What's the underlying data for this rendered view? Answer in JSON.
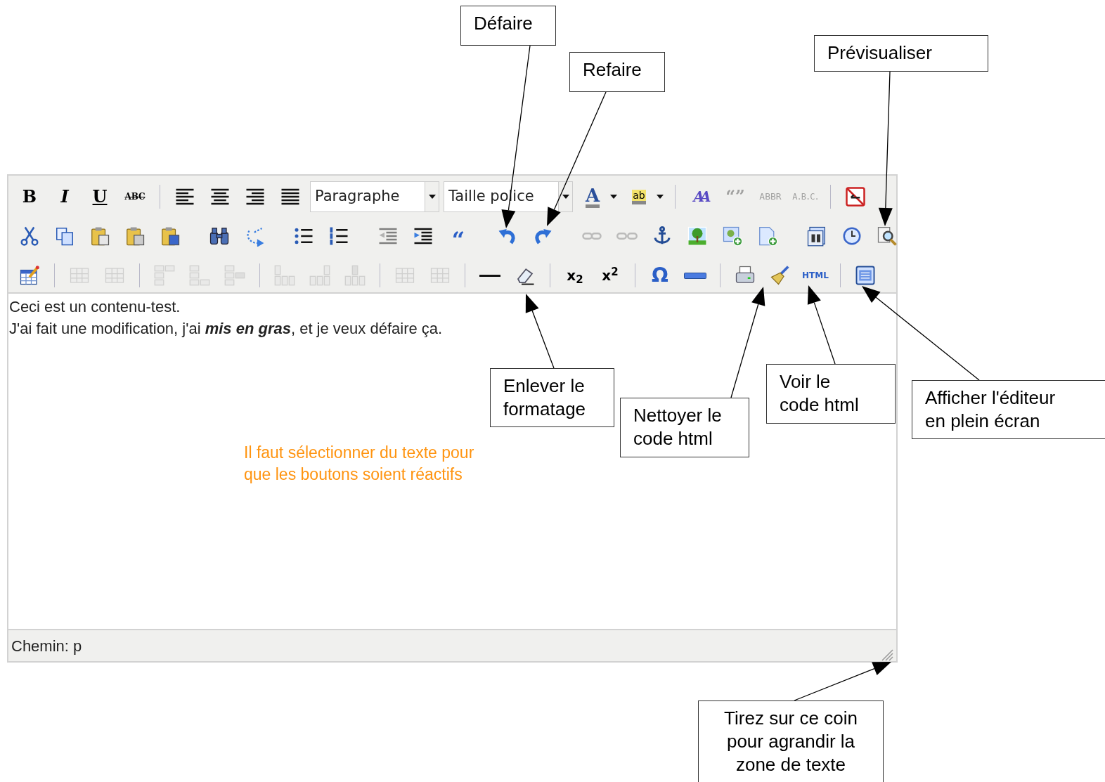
{
  "toolbar": {
    "rows": [
      [
        {
          "kind": "bold",
          "glyph": "B",
          "disabled": false
        },
        {
          "kind": "italic",
          "glyph": "I",
          "disabled": false
        },
        {
          "kind": "underline",
          "glyph": "U",
          "disabled": false
        },
        {
          "kind": "strike",
          "glyph": "ABC",
          "disabled": false
        },
        {
          "kind": "separator"
        },
        {
          "kind": "alignleft",
          "disabled": false
        },
        {
          "kind": "aligncenter",
          "disabled": false
        },
        {
          "kind": "alignright",
          "disabled": false
        },
        {
          "kind": "alignjustify",
          "disabled": false
        },
        {
          "kind": "select",
          "value": "Paragraphe"
        },
        {
          "kind": "select",
          "value": "Taille police"
        },
        {
          "kind": "forecolor",
          "glyph": "A",
          "disabled": false
        },
        {
          "kind": "caret",
          "disabled": false
        },
        {
          "kind": "backcolor",
          "glyph": "ab",
          "disabled": false
        },
        {
          "kind": "caret",
          "disabled": false
        },
        {
          "kind": "separator"
        },
        {
          "kind": "styleprops",
          "glyph": "AA",
          "disabled": false
        },
        {
          "kind": "cite",
          "glyph": "“”",
          "disabled": true
        },
        {
          "kind": "abbr",
          "glyph": "ABBR",
          "disabled": true
        },
        {
          "kind": "acronym",
          "glyph": "A.B.C.",
          "disabled": true
        },
        {
          "kind": "separator"
        },
        {
          "kind": "visualaid",
          "disabled": false
        }
      ],
      [
        {
          "kind": "cut",
          "disabled": false
        },
        {
          "kind": "copy",
          "disabled": false
        },
        {
          "kind": "paste",
          "disabled": false
        },
        {
          "kind": "pastetext",
          "disabled": false
        },
        {
          "kind": "pasteword",
          "disabled": false
        },
        {
          "kind": "separator"
        },
        {
          "kind": "search",
          "disabled": false
        },
        {
          "kind": "replace",
          "disabled": false
        },
        {
          "kind": "separator"
        },
        {
          "kind": "bullist",
          "disabled": false
        },
        {
          "kind": "numlist",
          "disabled": false
        },
        {
          "kind": "separator"
        },
        {
          "kind": "outdent",
          "disabled": true
        },
        {
          "kind": "indent",
          "disabled": false
        },
        {
          "kind": "blockquote",
          "glyph": "“",
          "disabled": false
        },
        {
          "kind": "separator"
        },
        {
          "kind": "undo",
          "disabled": false
        },
        {
          "kind": "redo",
          "disabled": false
        },
        {
          "kind": "separator"
        },
        {
          "kind": "link",
          "disabled": true
        },
        {
          "kind": "unlink",
          "disabled": true
        },
        {
          "kind": "anchor",
          "disabled": false
        },
        {
          "kind": "image",
          "disabled": false
        },
        {
          "kind": "insertimage",
          "disabled": false
        },
        {
          "kind": "insertfile",
          "disabled": false
        },
        {
          "kind": "separator"
        },
        {
          "kind": "date",
          "disabled": false
        },
        {
          "kind": "time",
          "disabled": false
        },
        {
          "kind": "preview",
          "disabled": false
        }
      ],
      [
        {
          "kind": "table",
          "disabled": false
        },
        {
          "kind": "separator"
        },
        {
          "kind": "rowprops",
          "disabled": true
        },
        {
          "kind": "cellprops",
          "disabled": true
        },
        {
          "kind": "separator"
        },
        {
          "kind": "rowbefore",
          "disabled": true
        },
        {
          "kind": "rowafter",
          "disabled": true
        },
        {
          "kind": "deleterow",
          "disabled": true
        },
        {
          "kind": "separator"
        },
        {
          "kind": "colbefore",
          "disabled": true
        },
        {
          "kind": "colafter",
          "disabled": true
        },
        {
          "kind": "deletecol",
          "disabled": true
        },
        {
          "kind": "separator"
        },
        {
          "kind": "splitcells",
          "disabled": true
        },
        {
          "kind": "mergecells",
          "disabled": true
        },
        {
          "kind": "separator"
        },
        {
          "kind": "hr",
          "disabled": false
        },
        {
          "kind": "removeformat",
          "disabled": false
        },
        {
          "kind": "separator"
        },
        {
          "kind": "sub",
          "glyph": "x$_{2}$",
          "disabled": false
        },
        {
          "kind": "sup",
          "glyph": "x$^{2}$",
          "disabled": false
        },
        {
          "kind": "separator"
        },
        {
          "kind": "charmap",
          "glyph": "Ω",
          "disabled": false
        },
        {
          "kind": "advhr",
          "disabled": false
        },
        {
          "kind": "separator"
        },
        {
          "kind": "print",
          "disabled": false
        },
        {
          "kind": "cleanup",
          "disabled": false
        },
        {
          "kind": "code",
          "glyph": "HTML",
          "disabled": false
        },
        {
          "kind": "separator"
        },
        {
          "kind": "fullscreen",
          "disabled": false
        }
      ]
    ]
  },
  "content": {
    "lines": [
      "Ceci est un contenu-test.",
      "J'ai fait une modification, j'ai **mis en gras**, et je veux défaire ça."
    ]
  },
  "status_bar": {
    "path": "Chemin: p"
  },
  "note": {
    "lines": [
      "Il faut sélectionner du texte pour",
      "que les boutons soient réactifs"
    ]
  },
  "callouts": [
    {
      "lines": [
        "Défaire"
      ]
    },
    {
      "lines": [
        "Refaire"
      ]
    },
    {
      "lines": [
        "Prévisualiser"
      ]
    },
    {
      "lines": [
        "Enlever le",
        "formatage"
      ]
    },
    {
      "lines": [
        "Nettoyer le",
        "code html"
      ]
    },
    {
      "lines": [
        "Voir le",
        "code html"
      ]
    },
    {
      "lines": [
        "Afficher l'éditeur",
        "en plein écran"
      ]
    },
    {
      "lines": [
        "Tirez sur ce coin",
        "pour agrandir la",
        "zone de texte"
      ]
    }
  ]
}
